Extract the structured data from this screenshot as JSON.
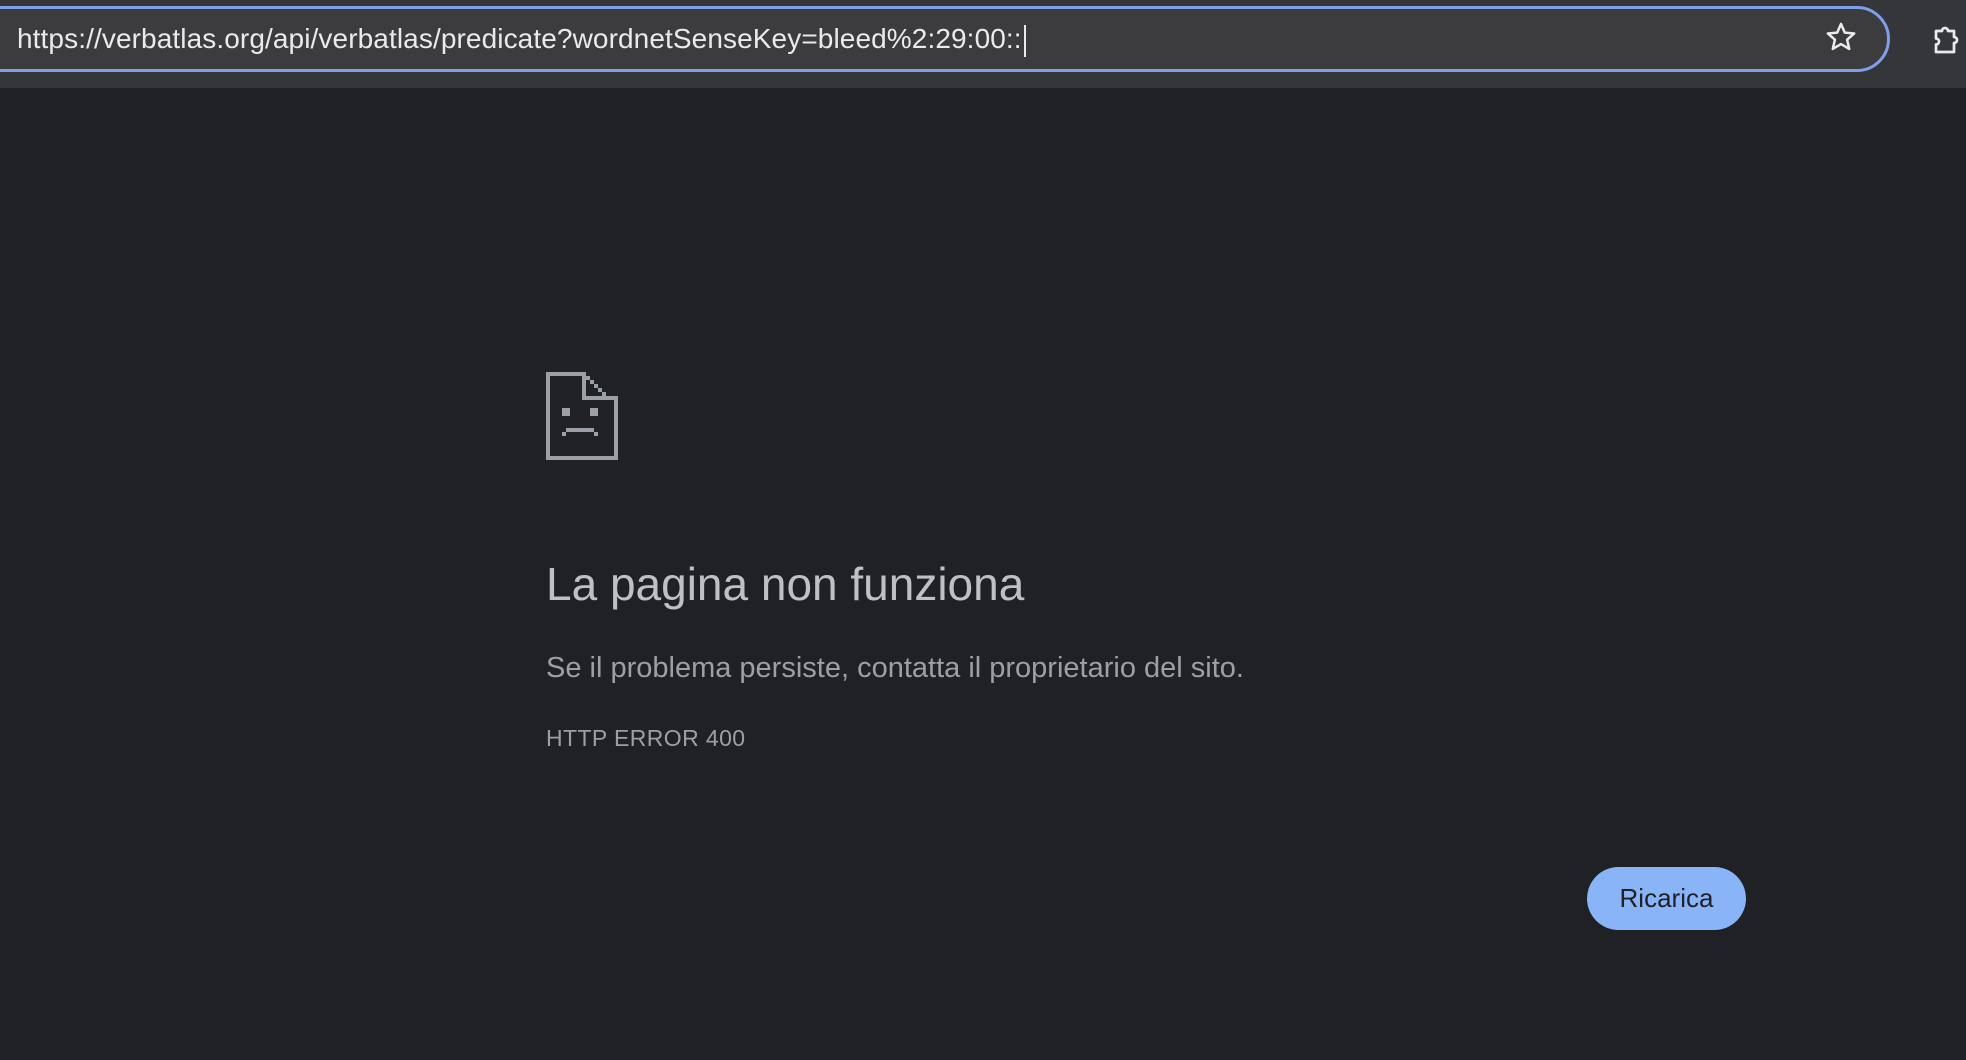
{
  "browser": {
    "address_bar": {
      "url": "https://verbatlas.org/api/verbatlas/predicate?wordnetSenseKey=bleed%2:29:00::",
      "bookmark_icon": "star-icon",
      "extensions_icon": "puzzle-icon"
    }
  },
  "error_page": {
    "icon": "sad-page-icon",
    "title": "La pagina non funziona",
    "message": "Se il problema persiste, contatta il proprietario del sito.",
    "error_code": "HTTP ERROR 400",
    "reload_button": "Ricarica"
  },
  "colors": {
    "background": "#202124",
    "toolbar": "#35363a",
    "omnibox_focus_border": "#7ea0e8",
    "button": "#8ab4f8"
  }
}
